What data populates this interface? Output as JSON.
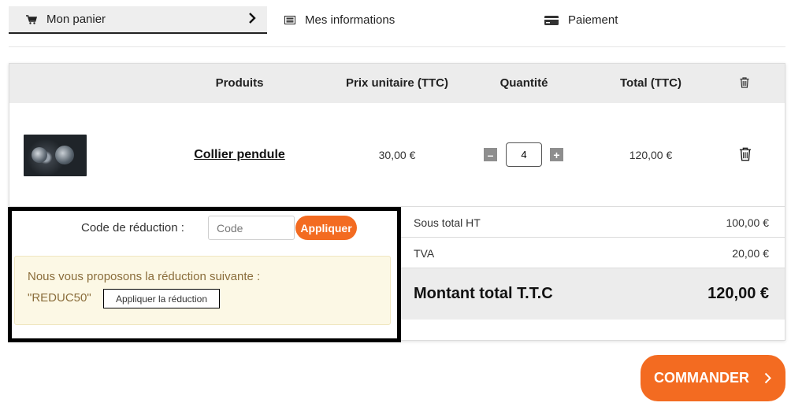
{
  "steps": [
    {
      "label": "Mon panier",
      "icon": "cart-icon"
    },
    {
      "label": "Mes informations",
      "icon": "list-icon"
    },
    {
      "label": "Paiement",
      "icon": "credit-card-icon"
    }
  ],
  "table": {
    "headers": [
      "Produits",
      "Prix unitaire (TTC)",
      "Quantité",
      "Total (TTC)"
    ],
    "items": [
      {
        "name": "Collier pendule",
        "unit_price": "30,00 €",
        "quantity": "4",
        "total": "120,00 €"
      }
    ]
  },
  "discount": {
    "label": "Code de réduction :",
    "placeholder": "Code",
    "apply_label": "Appliquer",
    "suggestion_text": "Nous vous proposons la réduction suivante :",
    "suggestion_code": "\"REDUC50\"",
    "suggestion_button": "Appliquer la réduction"
  },
  "totals": {
    "subtotal_label": "Sous total HT",
    "subtotal_value": "100,00 €",
    "tax_label": "TVA",
    "tax_value": "20,00 €",
    "grand_label": "Montant total T.T.C",
    "grand_value": "120,00 €"
  },
  "order_button": "COMMANDER",
  "colors": {
    "accent": "#f36b21",
    "alert_bg": "#fcf8e5",
    "alert_text": "#8a6d3b"
  }
}
